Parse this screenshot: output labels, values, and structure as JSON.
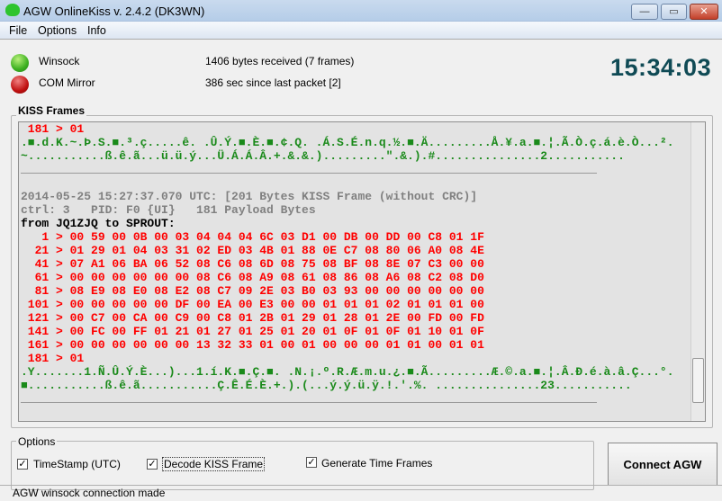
{
  "window": {
    "title": "AGW OnlineKiss v. 2.4.2  (DK3WN)",
    "minimize": "—",
    "maximize": "▭",
    "close": "✕"
  },
  "menu": [
    "File",
    "Options",
    "Info"
  ],
  "status_rows": [
    {
      "name": "Winsock",
      "info": "1406 bytes received (7 frames)",
      "color": "#3cb020"
    },
    {
      "name": "COM Mirror",
      "info": "386 sec since last packet [2]",
      "color": "#c01010"
    }
  ],
  "clock": "15:34:03",
  "kiss": {
    "label": "KISS Frames",
    "lines": [
      {
        "c": "red",
        "t": " 181 > 01"
      },
      {
        "c": "green",
        "t": ".■.d.K.~.Þ.S.■.³.ç.....ê. .Û.Ý.■.È.■.¢.Q. .Á.S.É.n.q.½.■.Ä.........Å.¥.a.■.¦.Ã.Ò.ç.á.è.Ò...²."
      },
      {
        "c": "green",
        "t": "~...........ß.ê.ã...ü.ü.ý...Ü.Á.Á.Â.+.&.&.).........\".&.).#...............2..........."
      },
      {
        "c": "div",
        "t": ""
      },
      {
        "c": "blank",
        "t": ""
      },
      {
        "c": "gray",
        "t": "2014-05-25 15:27:37.070 UTC: [201 Bytes KISS Frame (without CRC)]"
      },
      {
        "c": "gray",
        "t": "ctrl: 3   PID: F0 {UI}   181 Payload Bytes"
      },
      {
        "c": "blk",
        "t": "from JQ1ZJQ to SPROUT:"
      },
      {
        "c": "red",
        "t": "   1 > 00 59 00 0B 00 03 04 04 04 6C 03 D1 00 DB 00 DD 00 C8 01 1F"
      },
      {
        "c": "red",
        "t": "  21 > 01 29 01 04 03 31 02 ED 03 4B 01 88 0E C7 08 80 06 A0 08 4E"
      },
      {
        "c": "red",
        "t": "  41 > 07 A1 06 BA 06 52 08 C6 08 6D 08 75 08 BF 08 8E 07 C3 00 00"
      },
      {
        "c": "red",
        "t": "  61 > 00 00 00 00 00 00 08 C6 08 A9 08 61 08 86 08 A6 08 C2 08 D0"
      },
      {
        "c": "red",
        "t": "  81 > 08 E9 08 E0 08 E2 08 C7 09 2E 03 B0 03 93 00 00 00 00 00 00"
      },
      {
        "c": "red",
        "t": " 101 > 00 00 00 00 00 DF 00 EA 00 E3 00 00 01 01 01 02 01 01 01 00"
      },
      {
        "c": "red",
        "t": " 121 > 00 C7 00 CA 00 C9 00 C8 01 2B 01 29 01 28 01 2E 00 FD 00 FD"
      },
      {
        "c": "red",
        "t": " 141 > 00 FC 00 FF 01 21 01 27 01 25 01 20 01 0F 01 0F 01 10 01 0F"
      },
      {
        "c": "red",
        "t": " 161 > 00 00 00 00 00 00 13 32 33 01 00 01 00 00 00 01 01 00 01 01"
      },
      {
        "c": "red",
        "t": " 181 > 01"
      },
      {
        "c": "green",
        "t": ".Y.......1.Ñ.Û.Ý.È...)...1.í.K.■.Ç.■. .N.¡.º.R.Æ.m.u.¿.■.Ã.........Æ.©.a.■.¦.Â.Ð.é.à.â.Ç...°."
      },
      {
        "c": "green",
        "t": "■...........ß.ê.ã...........Ç.Ê.É.È.+.).(...ý.ý.ü.ÿ.!.'.%. ...............23..........."
      },
      {
        "c": "div",
        "t": ""
      }
    ]
  },
  "options": {
    "label": "Options",
    "checkboxes": [
      {
        "label": "TimeStamp (UTC)",
        "checked": true
      },
      {
        "label": "Decode KISS Frame",
        "checked": true
      },
      {
        "label": "Generate Time Frames",
        "checked": true
      }
    ],
    "check_glyph": "✓"
  },
  "connect_button": "Connect AGW",
  "statusbar": "AGW winsock connection made"
}
